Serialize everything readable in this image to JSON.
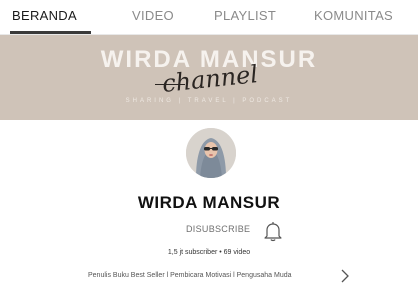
{
  "tabs": [
    {
      "label": "BERANDA",
      "active": true
    },
    {
      "label": "VIDEO",
      "active": false
    },
    {
      "label": "PLAYLIST",
      "active": false
    },
    {
      "label": "KOMUNITAS",
      "active": false
    }
  ],
  "banner": {
    "title": "WIRDA MANSUR",
    "script": "channel",
    "tagline": "SHARING | TRAVEL | PODCAST"
  },
  "channel": {
    "name": "WIRDA MANSUR",
    "subscribe_label": "DISUBSCRIBE",
    "stats": "1,5 jt subscriber • 69 video",
    "description": "Penulis Buku Best Seller l Pembicara Motivasi l Pengusaha Muda"
  },
  "icons": {
    "bell": "bell-icon",
    "chevron": "chevron-right-icon",
    "avatar": "avatar-image"
  },
  "colors": {
    "banner_bg": "#cfc3b8",
    "accent_underline": "#3a3a3a"
  }
}
